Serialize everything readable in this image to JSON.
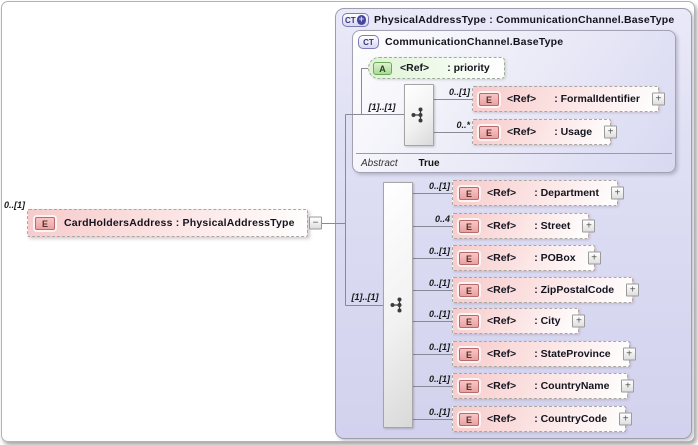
{
  "root": {
    "cardinality": "0..[1]",
    "icon": "E",
    "label": "CardHoldersAddress : PhysicalAddressType",
    "collapse": "−"
  },
  "container": {
    "icon_text": "CT",
    "icon_plus": "+",
    "title": "PhysicalAddressType : CommunicationChannel.BaseType",
    "sequence_cardinality": "[1]..[1]",
    "base": {
      "icon_text": "CT",
      "title": "CommunicationChannel.BaseType",
      "attribute": {
        "icon": "A",
        "ref": "<Ref>",
        "name": ": priority"
      },
      "sequence_cardinality": "[1]..[1]",
      "elements": [
        {
          "cardinality": "0..[1]",
          "icon": "E",
          "ref": "<Ref>",
          "name": ": FormalIdentifier",
          "expand": "+"
        },
        {
          "cardinality": "0..*",
          "icon": "E",
          "ref": "<Ref>",
          "name": ": Usage",
          "expand": "+"
        }
      ],
      "footer_label": "Abstract",
      "footer_value": "True"
    },
    "elements": [
      {
        "cardinality": "0..[1]",
        "icon": "E",
        "ref": "<Ref>",
        "name": ": Department",
        "expand": "+"
      },
      {
        "cardinality": "0..4",
        "icon": "E",
        "ref": "<Ref>",
        "name": ": Street",
        "expand": "+"
      },
      {
        "cardinality": "0..[1]",
        "icon": "E",
        "ref": "<Ref>",
        "name": ": POBox",
        "expand": "+"
      },
      {
        "cardinality": "0..[1]",
        "icon": "E",
        "ref": "<Ref>",
        "name": ": ZipPostalCode",
        "expand": "+"
      },
      {
        "cardinality": "0..[1]",
        "icon": "E",
        "ref": "<Ref>",
        "name": ": City",
        "expand": "+"
      },
      {
        "cardinality": "0..[1]",
        "icon": "E",
        "ref": "<Ref>",
        "name": ": StateProvince",
        "expand": "+"
      },
      {
        "cardinality": "0..[1]",
        "icon": "E",
        "ref": "<Ref>",
        "name": ": CountryName",
        "expand": "+"
      },
      {
        "cardinality": "0..[1]",
        "icon": "E",
        "ref": "<Ref>",
        "name": ": CountryCode",
        "expand": "+"
      }
    ]
  }
}
